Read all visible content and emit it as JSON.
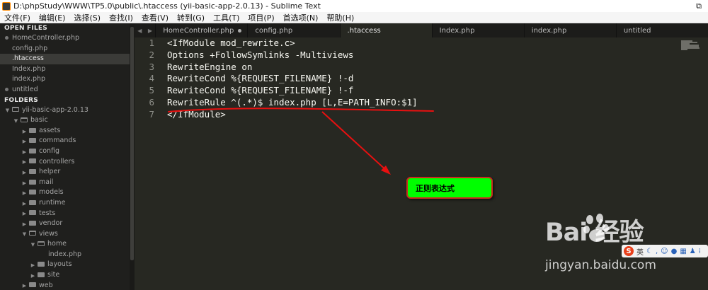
{
  "window": {
    "title": "D:\\phpStudy\\WWW\\TP5.0\\public\\.htaccess (yii-basic-app-2.0.13) - Sublime Text",
    "restore_glyph": "⧉"
  },
  "menu": [
    "文件(F)",
    "编辑(E)",
    "选择(S)",
    "查找(I)",
    "查看(V)",
    "转到(G)",
    "工具(T)",
    "项目(P)",
    "首选项(N)",
    "帮助(H)"
  ],
  "sidebar": {
    "open_files_header": "OPEN FILES",
    "open_files": [
      {
        "label": "HomeController.php",
        "dirty": true,
        "active": false
      },
      {
        "label": "config.php",
        "dirty": false,
        "active": false
      },
      {
        "label": ".htaccess",
        "dirty": false,
        "active": true
      },
      {
        "label": "Index.php",
        "dirty": false,
        "active": false
      },
      {
        "label": "index.php",
        "dirty": false,
        "active": false
      },
      {
        "label": "untitled",
        "dirty": true,
        "active": false
      }
    ],
    "folders_header": "FOLDERS",
    "tree": [
      {
        "label": "yii-basic-app-2.0.13",
        "depth": 0,
        "kind": "folder-open"
      },
      {
        "label": "basic",
        "depth": 1,
        "kind": "folder-open"
      },
      {
        "label": "assets",
        "depth": 2,
        "kind": "folder"
      },
      {
        "label": "commands",
        "depth": 2,
        "kind": "folder"
      },
      {
        "label": "config",
        "depth": 2,
        "kind": "folder"
      },
      {
        "label": "controllers",
        "depth": 2,
        "kind": "folder"
      },
      {
        "label": "helper",
        "depth": 2,
        "kind": "folder"
      },
      {
        "label": "mail",
        "depth": 2,
        "kind": "folder"
      },
      {
        "label": "models",
        "depth": 2,
        "kind": "folder"
      },
      {
        "label": "runtime",
        "depth": 2,
        "kind": "folder"
      },
      {
        "label": "tests",
        "depth": 2,
        "kind": "folder"
      },
      {
        "label": "vendor",
        "depth": 2,
        "kind": "folder"
      },
      {
        "label": "views",
        "depth": 2,
        "kind": "folder-open"
      },
      {
        "label": "home",
        "depth": 3,
        "kind": "folder-open"
      },
      {
        "label": "index.php",
        "depth": 4,
        "kind": "file"
      },
      {
        "label": "layouts",
        "depth": 3,
        "kind": "folder"
      },
      {
        "label": "site",
        "depth": 3,
        "kind": "folder"
      },
      {
        "label": "web",
        "depth": 2,
        "kind": "folder"
      }
    ]
  },
  "tabs": [
    {
      "label": "HomeController.php",
      "dirty": true,
      "active": false
    },
    {
      "label": "config.php",
      "dirty": false,
      "active": false
    },
    {
      "label": ".htaccess",
      "dirty": false,
      "active": true
    },
    {
      "label": "Index.php",
      "dirty": false,
      "active": false
    },
    {
      "label": "index.php",
      "dirty": false,
      "active": false
    },
    {
      "label": "untitled",
      "dirty": false,
      "active": false
    }
  ],
  "editor": {
    "lines": [
      "<IfModule mod_rewrite.c>",
      "Options +FollowSymlinks -Multiviews",
      "RewriteEngine on",
      "RewriteCond %{REQUEST_FILENAME} !-d",
      "RewriteCond %{REQUEST_FILENAME} !-f",
      "RewriteRule ^(.*)$ index.php [L,E=PATH_INFO:$1]",
      "</IfModule>"
    ]
  },
  "annotation": {
    "callout_text": "正则表达式",
    "callout_color": "#00ff00",
    "line_color": "#e81010"
  },
  "watermark": {
    "logo": "Bai  经验",
    "url": "jingyan.baidu.com"
  },
  "ime": {
    "logo": "S",
    "mode": "英"
  }
}
